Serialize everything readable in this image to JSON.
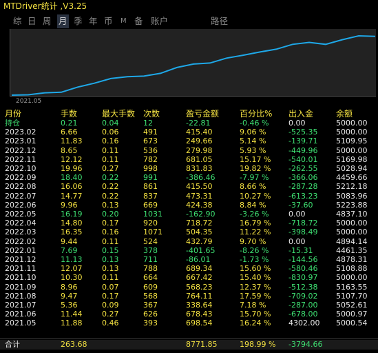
{
  "window": {
    "title": "MTDriver统计 ,V3.25"
  },
  "tabs": [
    {
      "label": "综",
      "active": false
    },
    {
      "label": "日",
      "active": false
    },
    {
      "label": "周",
      "active": false
    },
    {
      "label": "月",
      "active": true
    },
    {
      "label": "季",
      "active": false
    },
    {
      "label": "年",
      "active": false
    },
    {
      "label": "币",
      "active": false
    },
    {
      "label": "M",
      "active": false
    },
    {
      "label": "备",
      "active": false
    },
    {
      "label": "账户",
      "active": false
    },
    {
      "label": "路径",
      "active": false
    }
  ],
  "chart": {
    "x_label": "2021.05",
    "line_color": "#1ea8e8",
    "cumulative_profit": [
      0,
      46.7,
      344.4,
      427.9,
      1192.1,
      1765.8,
      2455.3,
      2725.9,
      2813.9,
      3227.1,
      4089.9,
      4599.3,
      4758.1,
      5476.3,
      5900.8,
      6374.3,
      6789.8,
      7521.4,
      7800.4,
      7520.4,
      8200.4,
      8771.85,
      8700.9
    ]
  },
  "table": {
    "headers": [
      "月份",
      "手数",
      "最大手数",
      "次数",
      "盈亏金额",
      "百分比%",
      "出入金",
      "余额"
    ],
    "rows": [
      {
        "cells": [
          "持仓",
          "0.21",
          "0.04",
          "12",
          "-22.81",
          "-0.46 %",
          "0.00",
          "5000.00"
        ],
        "color": "green"
      },
      {
        "cells": [
          "2023.02",
          "6.66",
          "0.06",
          "491",
          "415.40",
          "9.06 %",
          "-525.35",
          "5000.00"
        ],
        "color": "yellow"
      },
      {
        "cells": [
          "2023.01",
          "11.83",
          "0.16",
          "673",
          "249.66",
          "5.14 %",
          "-139.71",
          "5109.95"
        ],
        "color": "yellow"
      },
      {
        "cells": [
          "2022.12",
          "8.65",
          "0.11",
          "536",
          "279.98",
          "5.93 %",
          "-449.96",
          "5000.00"
        ],
        "color": "yellow"
      },
      {
        "cells": [
          "2022.11",
          "12.12",
          "0.11",
          "782",
          "681.05",
          "15.17 %",
          "-540.01",
          "5169.98"
        ],
        "color": "yellow"
      },
      {
        "cells": [
          "2022.10",
          "19.96",
          "0.27",
          "998",
          "831.83",
          "19.82 %",
          "-262.55",
          "5028.94"
        ],
        "color": "yellow"
      },
      {
        "cells": [
          "2022.09",
          "18.40",
          "0.22",
          "991",
          "-386.46",
          "-7.97 %",
          "-366.06",
          "4459.66"
        ],
        "color": "green"
      },
      {
        "cells": [
          "2022.08",
          "16.06",
          "0.22",
          "861",
          "415.50",
          "8.66 %",
          "-287.28",
          "5212.18"
        ],
        "color": "yellow"
      },
      {
        "cells": [
          "2022.07",
          "14.77",
          "0.22",
          "837",
          "473.31",
          "10.27 %",
          "-613.23",
          "5083.96"
        ],
        "color": "yellow"
      },
      {
        "cells": [
          "2022.06",
          "9.96",
          "0.13",
          "669",
          "424.38",
          "8.84 %",
          "-37.60",
          "5223.88"
        ],
        "color": "yellow"
      },
      {
        "cells": [
          "2022.05",
          "16.19",
          "0.20",
          "1031",
          "-162.90",
          "-3.26 %",
          "0.00",
          "4837.10"
        ],
        "color": "green"
      },
      {
        "cells": [
          "2022.04",
          "14.80",
          "0.17",
          "920",
          "718.72",
          "16.79 %",
          "-718.72",
          "5000.00"
        ],
        "color": "yellow"
      },
      {
        "cells": [
          "2022.03",
          "16.35",
          "0.16",
          "1071",
          "504.35",
          "11.22 %",
          "-398.49",
          "5000.00"
        ],
        "color": "yellow"
      },
      {
        "cells": [
          "2022.02",
          "9.44",
          "0.11",
          "524",
          "432.79",
          "9.70 %",
          "0.00",
          "4894.14"
        ],
        "color": "yellow"
      },
      {
        "cells": [
          "2022.01",
          "7.69",
          "0.15",
          "378",
          "-401.65",
          "-8.26 %",
          "-15.31",
          "4461.35"
        ],
        "color": "green"
      },
      {
        "cells": [
          "2021.12",
          "11.13",
          "0.13",
          "711",
          "-86.01",
          "-1.73 %",
          "-144.56",
          "4878.31"
        ],
        "color": "green"
      },
      {
        "cells": [
          "2021.11",
          "12.07",
          "0.13",
          "788",
          "689.34",
          "15.60 %",
          "-580.46",
          "5108.88"
        ],
        "color": "yellow"
      },
      {
        "cells": [
          "2021.10",
          "10.30",
          "0.11",
          "664",
          "667.42",
          "15.40 %",
          "-830.97",
          "5000.00"
        ],
        "color": "yellow"
      },
      {
        "cells": [
          "2021.09",
          "8.96",
          "0.07",
          "609",
          "568.23",
          "12.37 %",
          "-512.38",
          "5163.55"
        ],
        "color": "yellow"
      },
      {
        "cells": [
          "2021.08",
          "9.47",
          "0.17",
          "568",
          "764.11",
          "17.59 %",
          "-709.02",
          "5107.70"
        ],
        "color": "yellow"
      },
      {
        "cells": [
          "2021.07",
          "5.36",
          "0.09",
          "367",
          "338.64",
          "7.18 %",
          "-287.00",
          "5052.61"
        ],
        "color": "yellow"
      },
      {
        "cells": [
          "2021.06",
          "11.44",
          "0.27",
          "626",
          "678.43",
          "15.70 %",
          "-678.00",
          "5000.97"
        ],
        "color": "yellow"
      },
      {
        "cells": [
          "2021.05",
          "11.88",
          "0.46",
          "393",
          "698.54",
          "16.24 %",
          "4302.00",
          "5000.54"
        ],
        "color": "yellow"
      }
    ],
    "total": {
      "cells": [
        "合计",
        "263.68",
        "",
        "",
        "8771.85",
        "198.99 %",
        "-3794.66",
        ""
      ]
    }
  }
}
